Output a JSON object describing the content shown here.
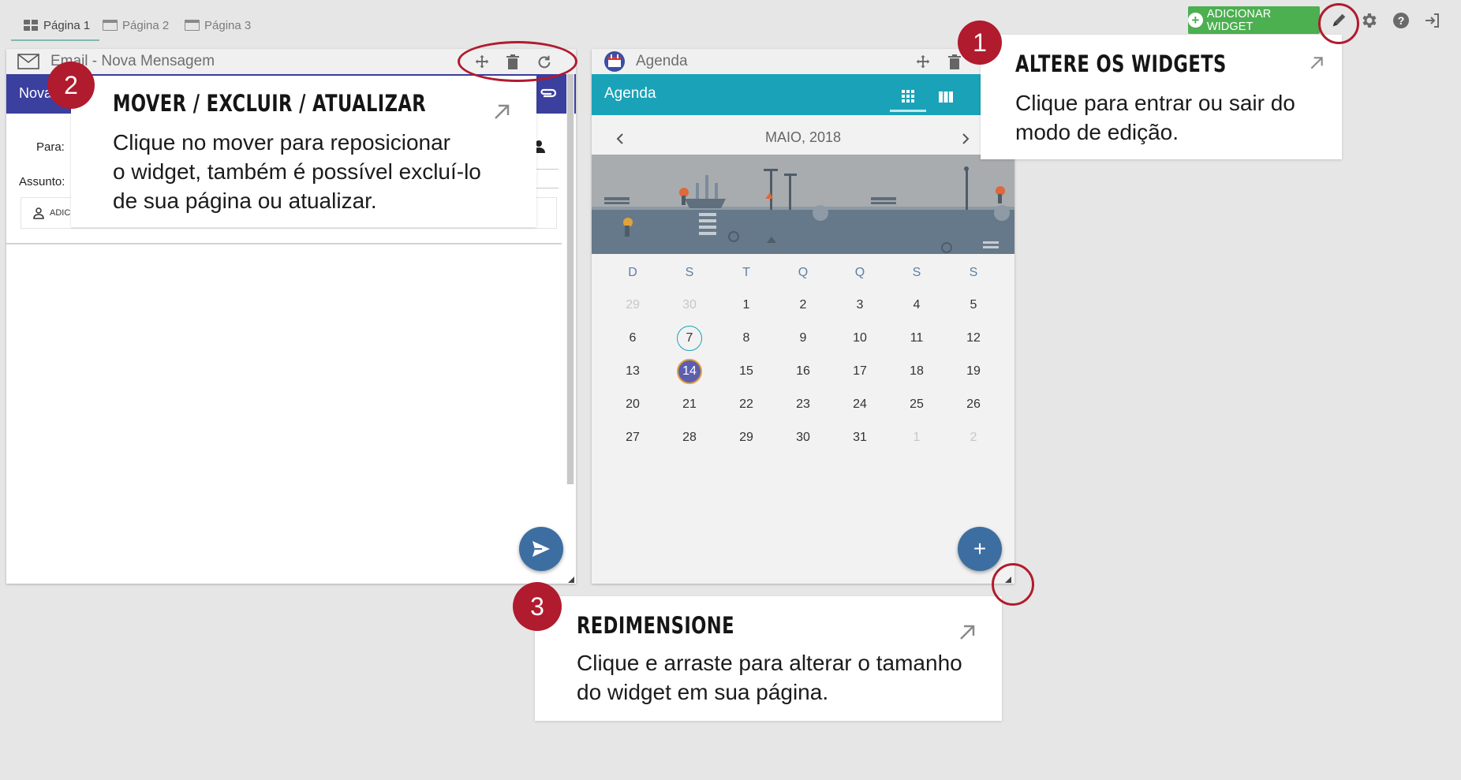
{
  "tabs": [
    {
      "label": "Página 1",
      "active": true
    },
    {
      "label": "Página 2",
      "active": false
    },
    {
      "label": "Página 3",
      "active": false
    }
  ],
  "toolbar": {
    "add_widget_label": "ADICIONAR WIDGET",
    "icons": [
      "edit-pencil-icon",
      "settings-icon",
      "help-icon",
      "logout-icon"
    ]
  },
  "email_widget": {
    "title": "Email - Nova Mensagem",
    "bar_title": "Nova",
    "to_label": "Para:",
    "subject_label": "Assunto:",
    "add_contact_label": "ADIC"
  },
  "agenda_widget": {
    "title": "Agenda",
    "bar_title": "Agenda",
    "month_label": "MAIO, 2018",
    "weekdays": [
      "D",
      "S",
      "T",
      "Q",
      "Q",
      "S",
      "S"
    ],
    "weeks": [
      [
        "29",
        "30",
        "1",
        "2",
        "3",
        "4",
        "5"
      ],
      [
        "6",
        "7",
        "8",
        "9",
        "10",
        "11",
        "12"
      ],
      [
        "13",
        "14",
        "15",
        "16",
        "17",
        "18",
        "19"
      ],
      [
        "20",
        "21",
        "22",
        "23",
        "24",
        "25",
        "26"
      ],
      [
        "27",
        "28",
        "29",
        "30",
        "31",
        "1",
        "2"
      ]
    ],
    "today": "7",
    "selected": "14"
  },
  "callouts": {
    "step1": {
      "number": "1",
      "heading": "ALTERE OS WIDGETS",
      "line1": "Clique para entrar ou sair do",
      "line2": "modo de edição."
    },
    "step2": {
      "number": "2",
      "heading": "MOVER / EXCLUIR / ATUALIZAR",
      "line1": "Clique no mover para reposicionar",
      "line2": "o widget, também é possível excluí-lo",
      "line3": "de sua página ou atualizar."
    },
    "step3": {
      "number": "3",
      "heading": "REDIMENSIONE",
      "line1": "Clique e arraste para alterar o tamanho",
      "line2": "do widget em sua página."
    }
  },
  "colors": {
    "accent_green": "#4caf50",
    "email_bar": "#3b3f9e",
    "agenda_bar": "#1aa3b8",
    "highlight_red": "#b01b2e",
    "fab_blue": "#3d6ea1"
  }
}
